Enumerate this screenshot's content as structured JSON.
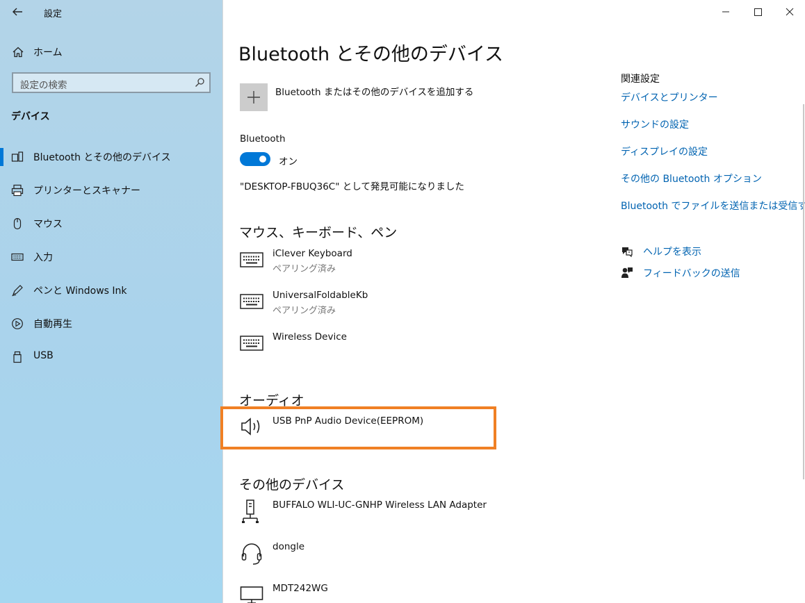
{
  "window": {
    "title": "設定"
  },
  "sidebar": {
    "home_label": "ホーム",
    "search_placeholder": "設定の検索",
    "section_title": "デバイス",
    "items": [
      {
        "label": "Bluetooth とその他のデバイス",
        "icon": "bluetooth-devices-icon",
        "selected": true
      },
      {
        "label": "プリンターとスキャナー",
        "icon": "printer-icon"
      },
      {
        "label": "マウス",
        "icon": "mouse-icon"
      },
      {
        "label": "入力",
        "icon": "keyboard-icon"
      },
      {
        "label": "ペンと Windows Ink",
        "icon": "pen-icon"
      },
      {
        "label": "自動再生",
        "icon": "autoplay-icon"
      },
      {
        "label": "USB",
        "icon": "usb-icon"
      }
    ]
  },
  "main": {
    "title": "Bluetooth とその他のデバイス",
    "add_device_label": "Bluetooth またはその他のデバイスを追加する",
    "bluetooth": {
      "label": "Bluetooth",
      "state": "オン",
      "discoverable_text": "\"DESKTOP-FBUQ36C\" として発見可能になりました"
    },
    "sections": {
      "input": {
        "title": "マウス、キーボード、ペン",
        "devices": [
          {
            "name": "iClever Keyboard",
            "status": "ペアリング済み",
            "icon": "keyboard-icon"
          },
          {
            "name": "UniversalFoldableKb",
            "status": "ペアリング済み",
            "icon": "keyboard-icon"
          },
          {
            "name": "Wireless Device",
            "status": "",
            "icon": "keyboard-icon"
          }
        ]
      },
      "audio": {
        "title": "オーディオ",
        "devices": [
          {
            "name": "USB PnP Audio Device(EEPROM)",
            "status": "",
            "icon": "speaker-icon"
          }
        ]
      },
      "other": {
        "title": "その他のデバイス",
        "devices": [
          {
            "name": "BUFFALO WLI-UC-GNHP Wireless LAN Adapter",
            "status": "",
            "icon": "network-device-icon"
          },
          {
            "name": "dongle",
            "status": "",
            "icon": "headset-icon"
          },
          {
            "name": "MDT242WG",
            "status": "",
            "icon": "monitor-icon"
          }
        ]
      }
    }
  },
  "related": {
    "title": "関連設定",
    "links": [
      "デバイスとプリンター",
      "サウンドの設定",
      "ディスプレイの設定",
      "その他の Bluetooth オプション",
      "Bluetooth でファイルを送信または受信する"
    ],
    "help_label": "ヘルプを表示",
    "feedback_label": "フィードバックの送信"
  },
  "colors": {
    "accent": "#0078d7",
    "link": "#0063b1",
    "highlight_border": "#f08024"
  }
}
